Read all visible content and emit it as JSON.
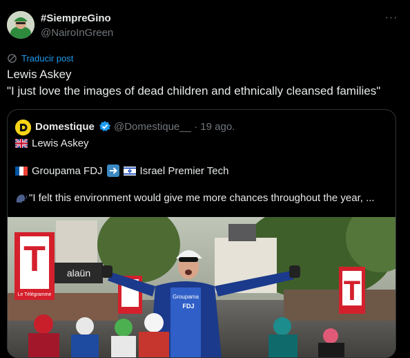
{
  "author": {
    "display_name": "#SiempreGino",
    "handle": "@NairoInGreen",
    "more_label": "···"
  },
  "translate_label": "Traducir post",
  "post_text": {
    "line1": "Lewis Askey",
    "line2": "\"I just love the images of dead children and ethnically cleansed families\""
  },
  "quoted": {
    "name": "Domestique",
    "handle_time": "@Domestique__ · 19 ago.",
    "line1": "Lewis Askey",
    "team_from": "Groupama FDJ",
    "team_to": "Israel Premier Tech",
    "quote": "\"I felt this environment would give me more chances throughout the year, ...",
    "image_banners": {
      "left_letter": "T",
      "left_sub": "Le Télégramme",
      "shop_sign": "alaün",
      "right_letter": "T",
      "jersey_brand": "Groupama",
      "jersey_team": "FDJ"
    }
  },
  "colors": {
    "accent": "#1d9bf0",
    "text": "#e7e9ea",
    "muted": "#71767b",
    "border": "#2f3336",
    "logo": "#f7d416"
  }
}
